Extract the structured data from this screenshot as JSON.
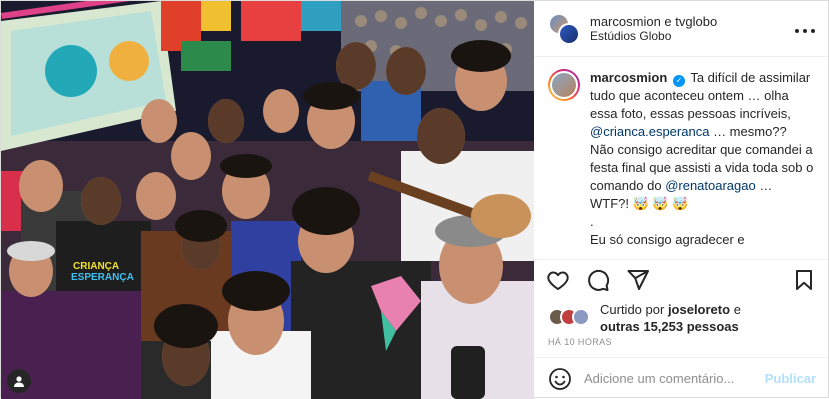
{
  "post": {
    "header": {
      "user1": "marcosmion",
      "conjunction": "e",
      "user2": "tvglobo",
      "location": "Estúdios Globo",
      "more_icon": "more-horizontal-icon"
    },
    "photo": {
      "sign_line1": "CRIANÇA",
      "sign_line2": "ESPERANÇA",
      "tag_icon": "user-tag-icon"
    },
    "caption": {
      "username": "marcosmion",
      "verified_icon": "verified-badge-icon",
      "text_part1": "Ta difícil de assimilar tudo que aconteceu ontem … olha essa foto, essas pessoas incríveis,",
      "mention1": "@crianca.esperanca",
      "text_part2": "… mesmo?? Não consigo acreditar que comandei a festa final que assisti a vida toda sob o comando do",
      "mention2": "@renatoaragao",
      "text_part3": "… WTF?! 🤯 🤯 🤯",
      "text_part4": ".",
      "text_part5": "Eu só consigo agradecer e"
    },
    "actions": {
      "like_icon": "heart-icon",
      "comment_icon": "comment-icon",
      "share_icon": "paper-plane-icon",
      "save_icon": "bookmark-icon"
    },
    "likes": {
      "prefix": "Curtido por",
      "user": "joseloreto",
      "and": "e",
      "others": "outras 15,253 pessoas"
    },
    "time": "HÁ 10 HORAS",
    "comment": {
      "emoji_icon": "emoji-smile-icon",
      "placeholder": "Adicione um comentário...",
      "publish_label": "Publicar"
    }
  }
}
